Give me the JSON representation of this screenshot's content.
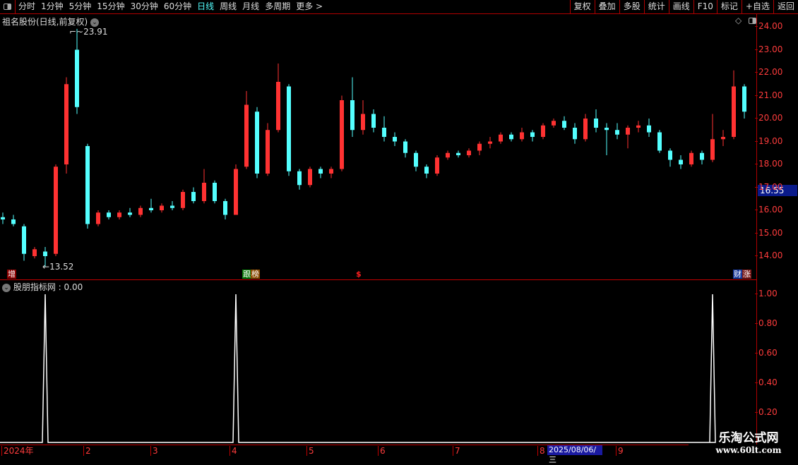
{
  "toolbar": {
    "periods": [
      "分时",
      "1分钟",
      "5分钟",
      "15分钟",
      "30分钟",
      "60分钟",
      "日线",
      "周线",
      "月线",
      "多周期",
      "更多 >"
    ],
    "active": "日线",
    "right": [
      "复权",
      "叠加",
      "多股",
      "统计",
      "画线",
      "F10",
      "标记",
      "+自选",
      "返回"
    ]
  },
  "chart_title": "祖名股份(日线,前复权)",
  "price_axis": {
    "ticks": [
      "24.00",
      "23.00",
      "22.00",
      "21.00",
      "20.00",
      "19.00",
      "18.00",
      "17.00",
      "16.00",
      "15.00",
      "14.00"
    ],
    "current": "16.55"
  },
  "annotations": {
    "high": "23.91",
    "low": "13.52"
  },
  "markers": [
    "增",
    "跟",
    "榜",
    "$",
    "财",
    "涨"
  ],
  "indicator": {
    "title": "股朋指标网",
    "value": ": 0.00",
    "ticks": [
      "1.00",
      "0.80",
      "0.60",
      "0.40",
      "0.20"
    ]
  },
  "date_axis": {
    "labels": [
      "2024年",
      "2",
      "3",
      "4",
      "5",
      "6",
      "7",
      "8",
      "9"
    ],
    "selected": "2025/08/06/三"
  },
  "watermark": {
    "name": "乐淘公式网",
    "url": "www.60lt.com"
  },
  "colors": {
    "up": "#ff3232",
    "down": "#54ffff",
    "grid": "#b00000",
    "line": "#ffffff"
  },
  "chart_data": {
    "type": "candlestick",
    "ylim": [
      13.5,
      24.3
    ],
    "ohlc": [
      [
        15.7,
        15.9,
        15.4,
        15.6
      ],
      [
        15.6,
        15.8,
        15.3,
        15.4
      ],
      [
        15.3,
        15.4,
        13.8,
        14.1
      ],
      [
        14.0,
        14.4,
        13.9,
        14.3
      ],
      [
        14.2,
        14.4,
        13.52,
        14.0
      ],
      [
        14.1,
        18.0,
        14.0,
        17.9
      ],
      [
        18.0,
        21.8,
        17.6,
        21.5
      ],
      [
        23.0,
        23.91,
        20.2,
        20.5
      ],
      [
        18.8,
        18.9,
        15.2,
        15.4
      ],
      [
        15.4,
        16.0,
        15.3,
        15.9
      ],
      [
        15.9,
        16.0,
        15.6,
        15.7
      ],
      [
        15.7,
        16.0,
        15.6,
        15.9
      ],
      [
        15.9,
        16.1,
        15.7,
        15.8
      ],
      [
        15.8,
        16.2,
        15.7,
        16.1
      ],
      [
        16.1,
        16.5,
        15.9,
        16.0
      ],
      [
        16.0,
        16.3,
        15.9,
        16.2
      ],
      [
        16.2,
        16.4,
        16.0,
        16.1
      ],
      [
        16.1,
        16.9,
        16.0,
        16.8
      ],
      [
        16.8,
        17.0,
        16.3,
        16.4
      ],
      [
        16.4,
        17.8,
        16.3,
        17.2
      ],
      [
        17.2,
        17.3,
        16.3,
        16.4
      ],
      [
        16.4,
        16.5,
        15.6,
        15.8
      ],
      [
        15.8,
        18.0,
        15.8,
        17.8
      ],
      [
        17.9,
        21.2,
        17.8,
        20.6
      ],
      [
        20.3,
        20.5,
        17.4,
        17.6
      ],
      [
        17.6,
        19.8,
        17.5,
        19.5
      ],
      [
        19.5,
        22.4,
        19.4,
        21.6
      ],
      [
        21.4,
        21.5,
        17.5,
        17.7
      ],
      [
        17.7,
        17.8,
        16.9,
        17.1
      ],
      [
        17.1,
        17.9,
        17.0,
        17.8
      ],
      [
        17.8,
        17.9,
        17.4,
        17.6
      ],
      [
        17.6,
        17.9,
        17.4,
        17.8
      ],
      [
        17.8,
        21.0,
        17.7,
        20.8
      ],
      [
        20.8,
        21.8,
        19.2,
        19.5
      ],
      [
        19.5,
        20.8,
        19.3,
        20.2
      ],
      [
        20.2,
        20.4,
        19.4,
        19.6
      ],
      [
        19.6,
        20.1,
        19.0,
        19.2
      ],
      [
        19.2,
        19.4,
        18.8,
        19.0
      ],
      [
        19.0,
        19.1,
        18.3,
        18.5
      ],
      [
        18.5,
        18.6,
        17.7,
        17.9
      ],
      [
        17.9,
        18.0,
        17.4,
        17.6
      ],
      [
        17.6,
        18.4,
        17.5,
        18.3
      ],
      [
        18.3,
        18.6,
        18.2,
        18.5
      ],
      [
        18.5,
        18.6,
        18.3,
        18.4
      ],
      [
        18.4,
        18.7,
        18.3,
        18.6
      ],
      [
        18.6,
        19.0,
        18.4,
        18.9
      ],
      [
        18.9,
        19.2,
        18.7,
        19.0
      ],
      [
        19.0,
        19.4,
        18.9,
        19.3
      ],
      [
        19.3,
        19.4,
        19.0,
        19.1
      ],
      [
        19.1,
        19.6,
        19.0,
        19.4
      ],
      [
        19.4,
        19.5,
        19.0,
        19.2
      ],
      [
        19.2,
        19.8,
        19.1,
        19.7
      ],
      [
        19.7,
        20.0,
        19.6,
        19.9
      ],
      [
        19.9,
        20.1,
        19.5,
        19.6
      ],
      [
        19.6,
        19.8,
        18.9,
        19.1
      ],
      [
        19.1,
        20.2,
        19.0,
        20.0
      ],
      [
        20.0,
        20.4,
        19.4,
        19.6
      ],
      [
        19.6,
        19.8,
        18.4,
        19.5
      ],
      [
        19.5,
        19.8,
        19.1,
        19.3
      ],
      [
        19.3,
        19.7,
        18.7,
        19.6
      ],
      [
        19.6,
        19.9,
        19.4,
        19.7
      ],
      [
        19.7,
        20.0,
        19.2,
        19.4
      ],
      [
        19.4,
        19.5,
        18.5,
        18.6
      ],
      [
        18.6,
        18.7,
        17.9,
        18.2
      ],
      [
        18.2,
        18.4,
        17.8,
        18.0
      ],
      [
        18.0,
        18.6,
        17.9,
        18.5
      ],
      [
        18.5,
        18.6,
        18.0,
        18.2
      ],
      [
        18.2,
        20.2,
        18.1,
        19.1
      ],
      [
        19.1,
        19.5,
        18.8,
        19.2
      ],
      [
        19.2,
        22.1,
        19.1,
        21.4
      ],
      [
        21.4,
        21.5,
        20.0,
        20.3
      ]
    ],
    "indicator_values": [
      0,
      0,
      0,
      0,
      1,
      0,
      0,
      0,
      0,
      0,
      0,
      0,
      0,
      0,
      0,
      0,
      0,
      0,
      0,
      0,
      0,
      0,
      1,
      0,
      0,
      0,
      0,
      0,
      0,
      0,
      0,
      0,
      0,
      0,
      0,
      0,
      0,
      0,
      0,
      0,
      0,
      0,
      0,
      0,
      0,
      0,
      0,
      0,
      0,
      0,
      0,
      0,
      0,
      0,
      0,
      0,
      0,
      0,
      0,
      0,
      0,
      0,
      0,
      0,
      0,
      0,
      0,
      1,
      0,
      0,
      0
    ],
    "indicator_ylim": [
      0,
      1.05
    ]
  }
}
